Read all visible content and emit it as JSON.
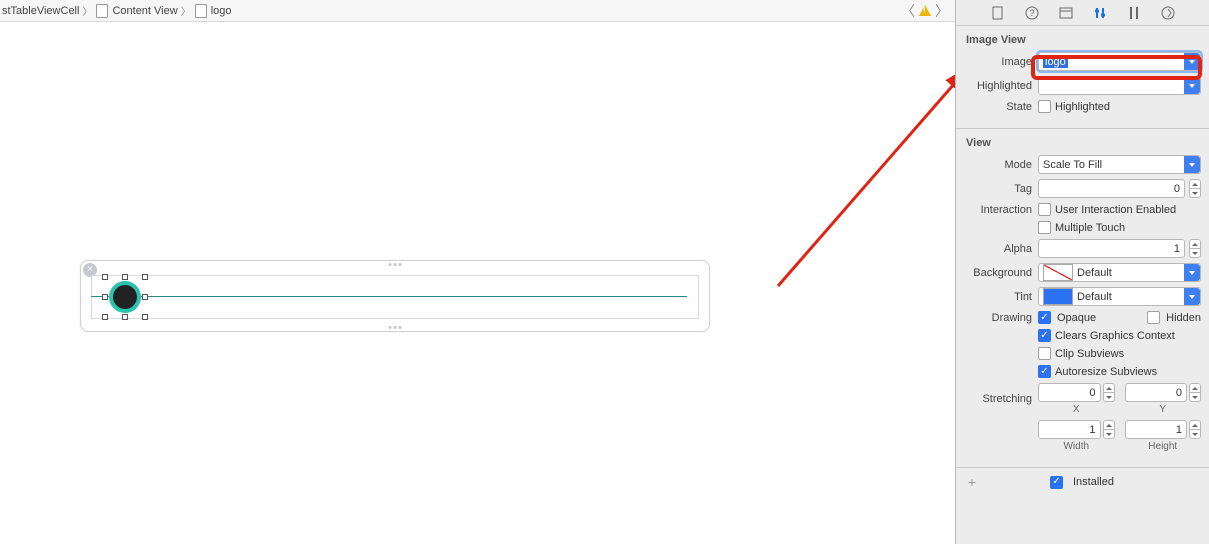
{
  "breadcrumb": {
    "item0": "stTableViewCell",
    "item1": "Content View",
    "item2": "logo"
  },
  "inspector": {
    "imageView": {
      "title": "Image View",
      "imageLabel": "Image",
      "imageValue": "logo",
      "highlightedLabel": "Highlighted",
      "highlightedValue": "",
      "stateLabel": "State",
      "stateCheckbox": "Highlighted"
    },
    "view": {
      "title": "View",
      "modeLabel": "Mode",
      "modeValue": "Scale To Fill",
      "tagLabel": "Tag",
      "tagValue": "0",
      "interactionLabel": "Interaction",
      "userInteraction": "User Interaction Enabled",
      "multipleTouch": "Multiple Touch",
      "alphaLabel": "Alpha",
      "alphaValue": "1",
      "backgroundLabel": "Background",
      "backgroundValue": "Default",
      "tintLabel": "Tint",
      "tintValue": "Default",
      "drawingLabel": "Drawing",
      "opaque": "Opaque",
      "hidden": "Hidden",
      "clearsGraphics": "Clears Graphics Context",
      "clipSubviews": "Clip Subviews",
      "autoresize": "Autoresize Subviews",
      "stretchingLabel": "Stretching",
      "stretchX": "0",
      "stretchY": "0",
      "stretchXLabel": "X",
      "stretchYLabel": "Y",
      "stretchW": "1",
      "stretchH": "1",
      "stretchWLabel": "Width",
      "stretchHLabel": "Height",
      "installed": "Installed"
    }
  }
}
